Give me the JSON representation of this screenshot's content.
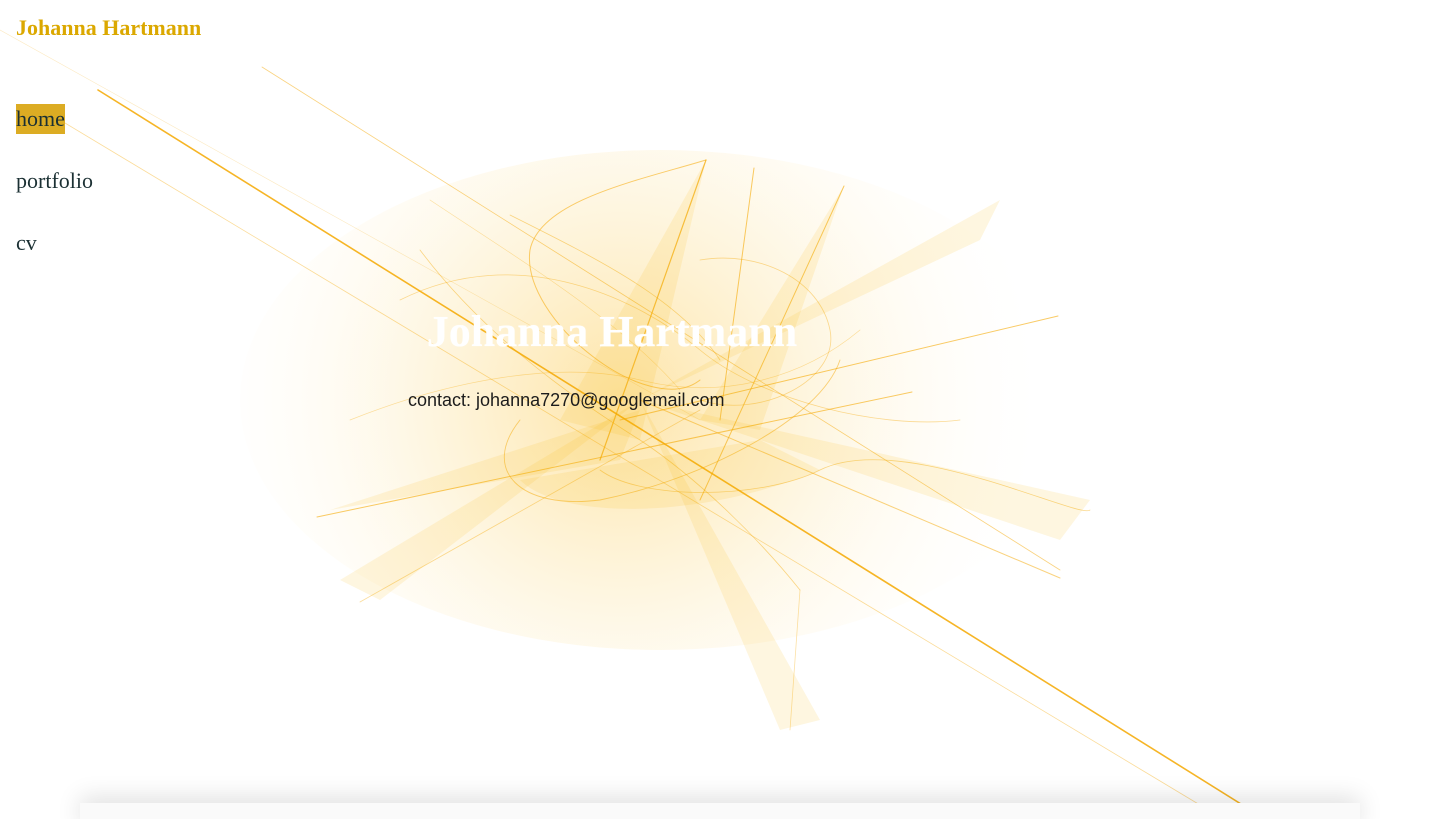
{
  "header": {
    "site_title": "Johanna Hartmann"
  },
  "nav": {
    "items": [
      {
        "label": "home",
        "active": true
      },
      {
        "label": "portfolio",
        "active": false
      },
      {
        "label": "cv",
        "active": false
      }
    ]
  },
  "hero": {
    "title": "Johanna Hartmann",
    "contact": "contact: johanna7270@googlemail.com"
  },
  "colors": {
    "accent": "#dcac23",
    "title": "#dba800",
    "text": "#1b3033",
    "artwork": "#f5a800"
  }
}
